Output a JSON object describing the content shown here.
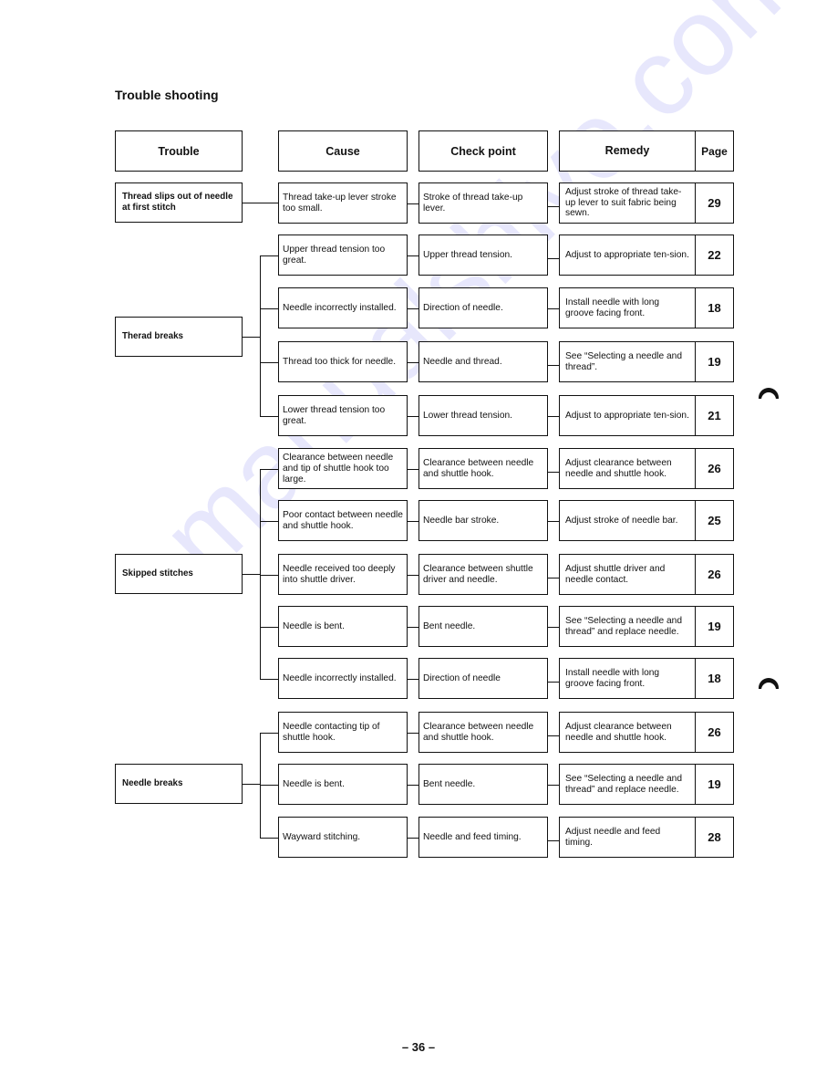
{
  "title": "Trouble shooting",
  "headers": {
    "trouble": "Trouble",
    "cause": "Cause",
    "check_point": "Check point",
    "remedy": "Remedy",
    "page": "Page"
  },
  "groups": [
    {
      "trouble": "Thread slips out of needle at first stitch",
      "rows": [
        {
          "cause": "Thread take-up lever stroke too small.",
          "check_point": "Stroke of thread take-up lever.",
          "remedy": "Adjust stroke of thread take-up lever to suit fabric being sewn.",
          "page": "29"
        }
      ]
    },
    {
      "trouble": "Therad breaks",
      "rows": [
        {
          "cause": "Upper thread tension too great.",
          "check_point": "Upper thread tension.",
          "remedy": "Adjust to appropriate ten-sion.",
          "page": "22"
        },
        {
          "cause": "Needle incorrectly installed.",
          "check_point": "Direction of needle.",
          "remedy": "Install needle with long groove facing front.",
          "page": "18"
        },
        {
          "cause": "Thread too thick for needle.",
          "check_point": "Needle and thread.",
          "remedy": "See “Selecting a needle and thread”.",
          "page": "19"
        },
        {
          "cause": "Lower thread tension too great.",
          "check_point": "Lower thread tension.",
          "remedy": "Adjust to appropriate ten-sion.",
          "page": "21"
        }
      ]
    },
    {
      "trouble": "Skipped stitches",
      "rows": [
        {
          "cause": "Clearance between needle and tip of shuttle hook too large.",
          "check_point": "Clearance between needle and shuttle hook.",
          "remedy": "Adjust clearance between needle and shuttle hook.",
          "page": "26"
        },
        {
          "cause": "Poor contact between needle and shuttle hook.",
          "check_point": "Needle bar stroke.",
          "remedy": "Adjust stroke of needle bar.",
          "page": "25"
        },
        {
          "cause": "Needle received too deeply into shuttle driver.",
          "check_point": "Clearance between shuttle driver and needle.",
          "remedy": "Adjust shuttle driver and needle contact.",
          "page": "26"
        },
        {
          "cause": "Needle is bent.",
          "check_point": "Bent needle.",
          "remedy": "See “Selecting a needle and thread” and replace needle.",
          "page": "19"
        },
        {
          "cause": "Needle incorrectly installed.",
          "check_point": "Direction of needle",
          "remedy": "Install needle with long groove facing front.",
          "page": "18"
        }
      ]
    },
    {
      "trouble": "Needle breaks",
      "rows": [
        {
          "cause": "Needle contacting tip of shuttle hook.",
          "check_point": "Clearance between needle and shuttle hook.",
          "remedy": "Adjust clearance between needle and shuttle hook.",
          "page": "26"
        },
        {
          "cause": "Needle is bent.",
          "check_point": "Bent needle.",
          "remedy": "See “Selecting a needle and thread” and replace needle.",
          "page": "19"
        },
        {
          "cause": "Wayward stitching.",
          "check_point": "Needle and feed timing.",
          "remedy": "Adjust needle and feed timing.",
          "page": "28"
        }
      ]
    }
  ],
  "page_number": "– 36 –",
  "watermark": "manualshive.com"
}
